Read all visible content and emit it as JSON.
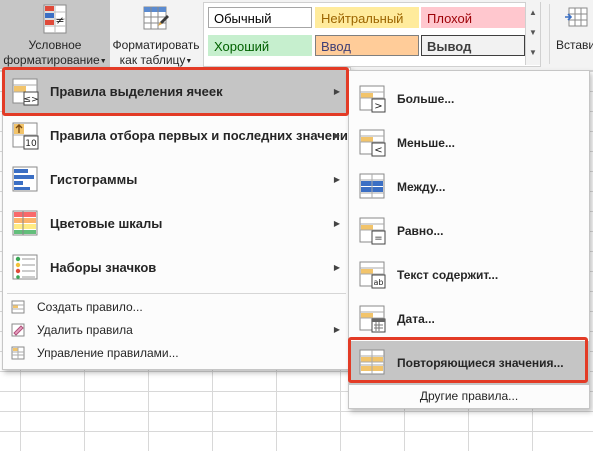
{
  "ribbon": {
    "conditional_formatting": {
      "line1": "Условное",
      "line2": "форматирование",
      "icon": "conditional-formatting-icon"
    },
    "format_as_table": {
      "line1": "Форматировать",
      "line2": "как таблицу",
      "icon": "format-table-icon"
    },
    "insert": {
      "line1": "Вставить",
      "icon": "insert-cells-icon"
    },
    "cell_styles": [
      {
        "name": "Обычный",
        "bg": "#ffffff",
        "fg": "#000000",
        "border": "#a6a6a6"
      },
      {
        "name": "Нейтральный",
        "bg": "#ffeb9c",
        "fg": "#9c6500"
      },
      {
        "name": "Плохой",
        "bg": "#ffc7ce",
        "fg": "#9c0006"
      },
      {
        "name": "Хороший",
        "bg": "#c6efce",
        "fg": "#006100"
      },
      {
        "name": "Ввод",
        "bg": "#ffcc99",
        "fg": "#3f3f76",
        "border": "#7f7f7f"
      },
      {
        "name": "Вывод",
        "bg": "#f2f2f2",
        "fg": "#3f3f3f",
        "border": "#3f3f3f"
      }
    ]
  },
  "menu": {
    "main_items": [
      {
        "label": "Правила выделения ячеек",
        "icon": "highlight-cells-rules-icon",
        "highlighted": true
      },
      {
        "label": "Правила отбора первых и последних значений",
        "icon": "top-bottom-rules-icon"
      },
      {
        "label": "Гистограммы",
        "icon": "data-bars-icon"
      },
      {
        "label": "Цветовые шкалы",
        "icon": "color-scales-icon"
      },
      {
        "label": "Наборы значков",
        "icon": "icon-sets-icon"
      }
    ],
    "small_items": [
      {
        "label": "Создать правило...",
        "icon": "new-rule-icon"
      },
      {
        "label": "Удалить правила",
        "icon": "clear-rules-icon",
        "has_submenu": true
      },
      {
        "label": "Управление правилами...",
        "icon": "manage-rules-icon"
      }
    ]
  },
  "submenu": {
    "items": [
      {
        "label": "Больше...",
        "icon": "greater-than-icon"
      },
      {
        "label": "Меньше...",
        "icon": "less-than-icon"
      },
      {
        "label": "Между...",
        "icon": "between-icon"
      },
      {
        "label": "Равно...",
        "icon": "equal-to-icon"
      },
      {
        "label": "Текст содержит...",
        "icon": "text-contains-icon"
      },
      {
        "label": "Дата...",
        "icon": "date-occurring-icon"
      },
      {
        "label": "Повторяющиеся значения...",
        "icon": "duplicate-values-icon",
        "highlighted": true
      }
    ],
    "more_rules": "Другие правила..."
  },
  "colors": {
    "highlight_outline": "#e33b26",
    "menu_highlight": "#c5c5c5",
    "ribbon_bg": "#f3f3f3"
  }
}
